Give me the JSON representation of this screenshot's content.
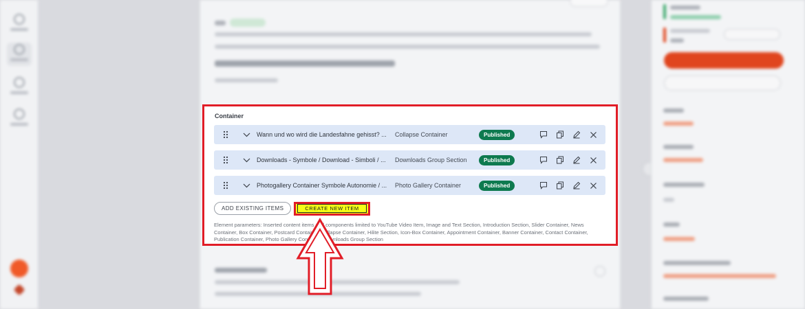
{
  "container": {
    "title": "Container",
    "items": [
      {
        "title": "Wann und wo wird die Landesfahne gehisst? ...",
        "type": "Collapse Container",
        "status": "Published"
      },
      {
        "title": "Downloads - Symbole / Download - Simboli / ...",
        "type": "Downloads Group Section",
        "status": "Published"
      },
      {
        "title": "Photogallery Container Symbole Autonomie / ...",
        "type": "Photo Gallery Container",
        "status": "Published"
      }
    ],
    "actions": {
      "add_existing": "ADD EXISTING ITEMS",
      "create_new": "CREATE NEW ITEM"
    },
    "parameters_text": "Element parameters: Inserted content items and components limited to YouTube Video Item, Image and Text Section, Introduction Section, Slider Container, News Container, Box Container, Postcard Container, Collapse Container, Hilite Section, Icon-Box Container, Appointment Container, Banner Container, Contact Container, Publication Container, Photo Gallery Container, Downloads Group Section"
  },
  "colors": {
    "highlight_red": "#e11d27",
    "highlight_yellow": "#f5ff16",
    "published_green": "#0e7a4f",
    "row_bg": "#dde7f7"
  },
  "icons": {
    "row_drag": "drag-handle-icon",
    "row_expand": "chevron-down-icon",
    "row_comment": "comment-icon",
    "row_duplicate": "duplicate-icon",
    "row_edit": "pencil-icon",
    "row_remove": "close-icon"
  }
}
